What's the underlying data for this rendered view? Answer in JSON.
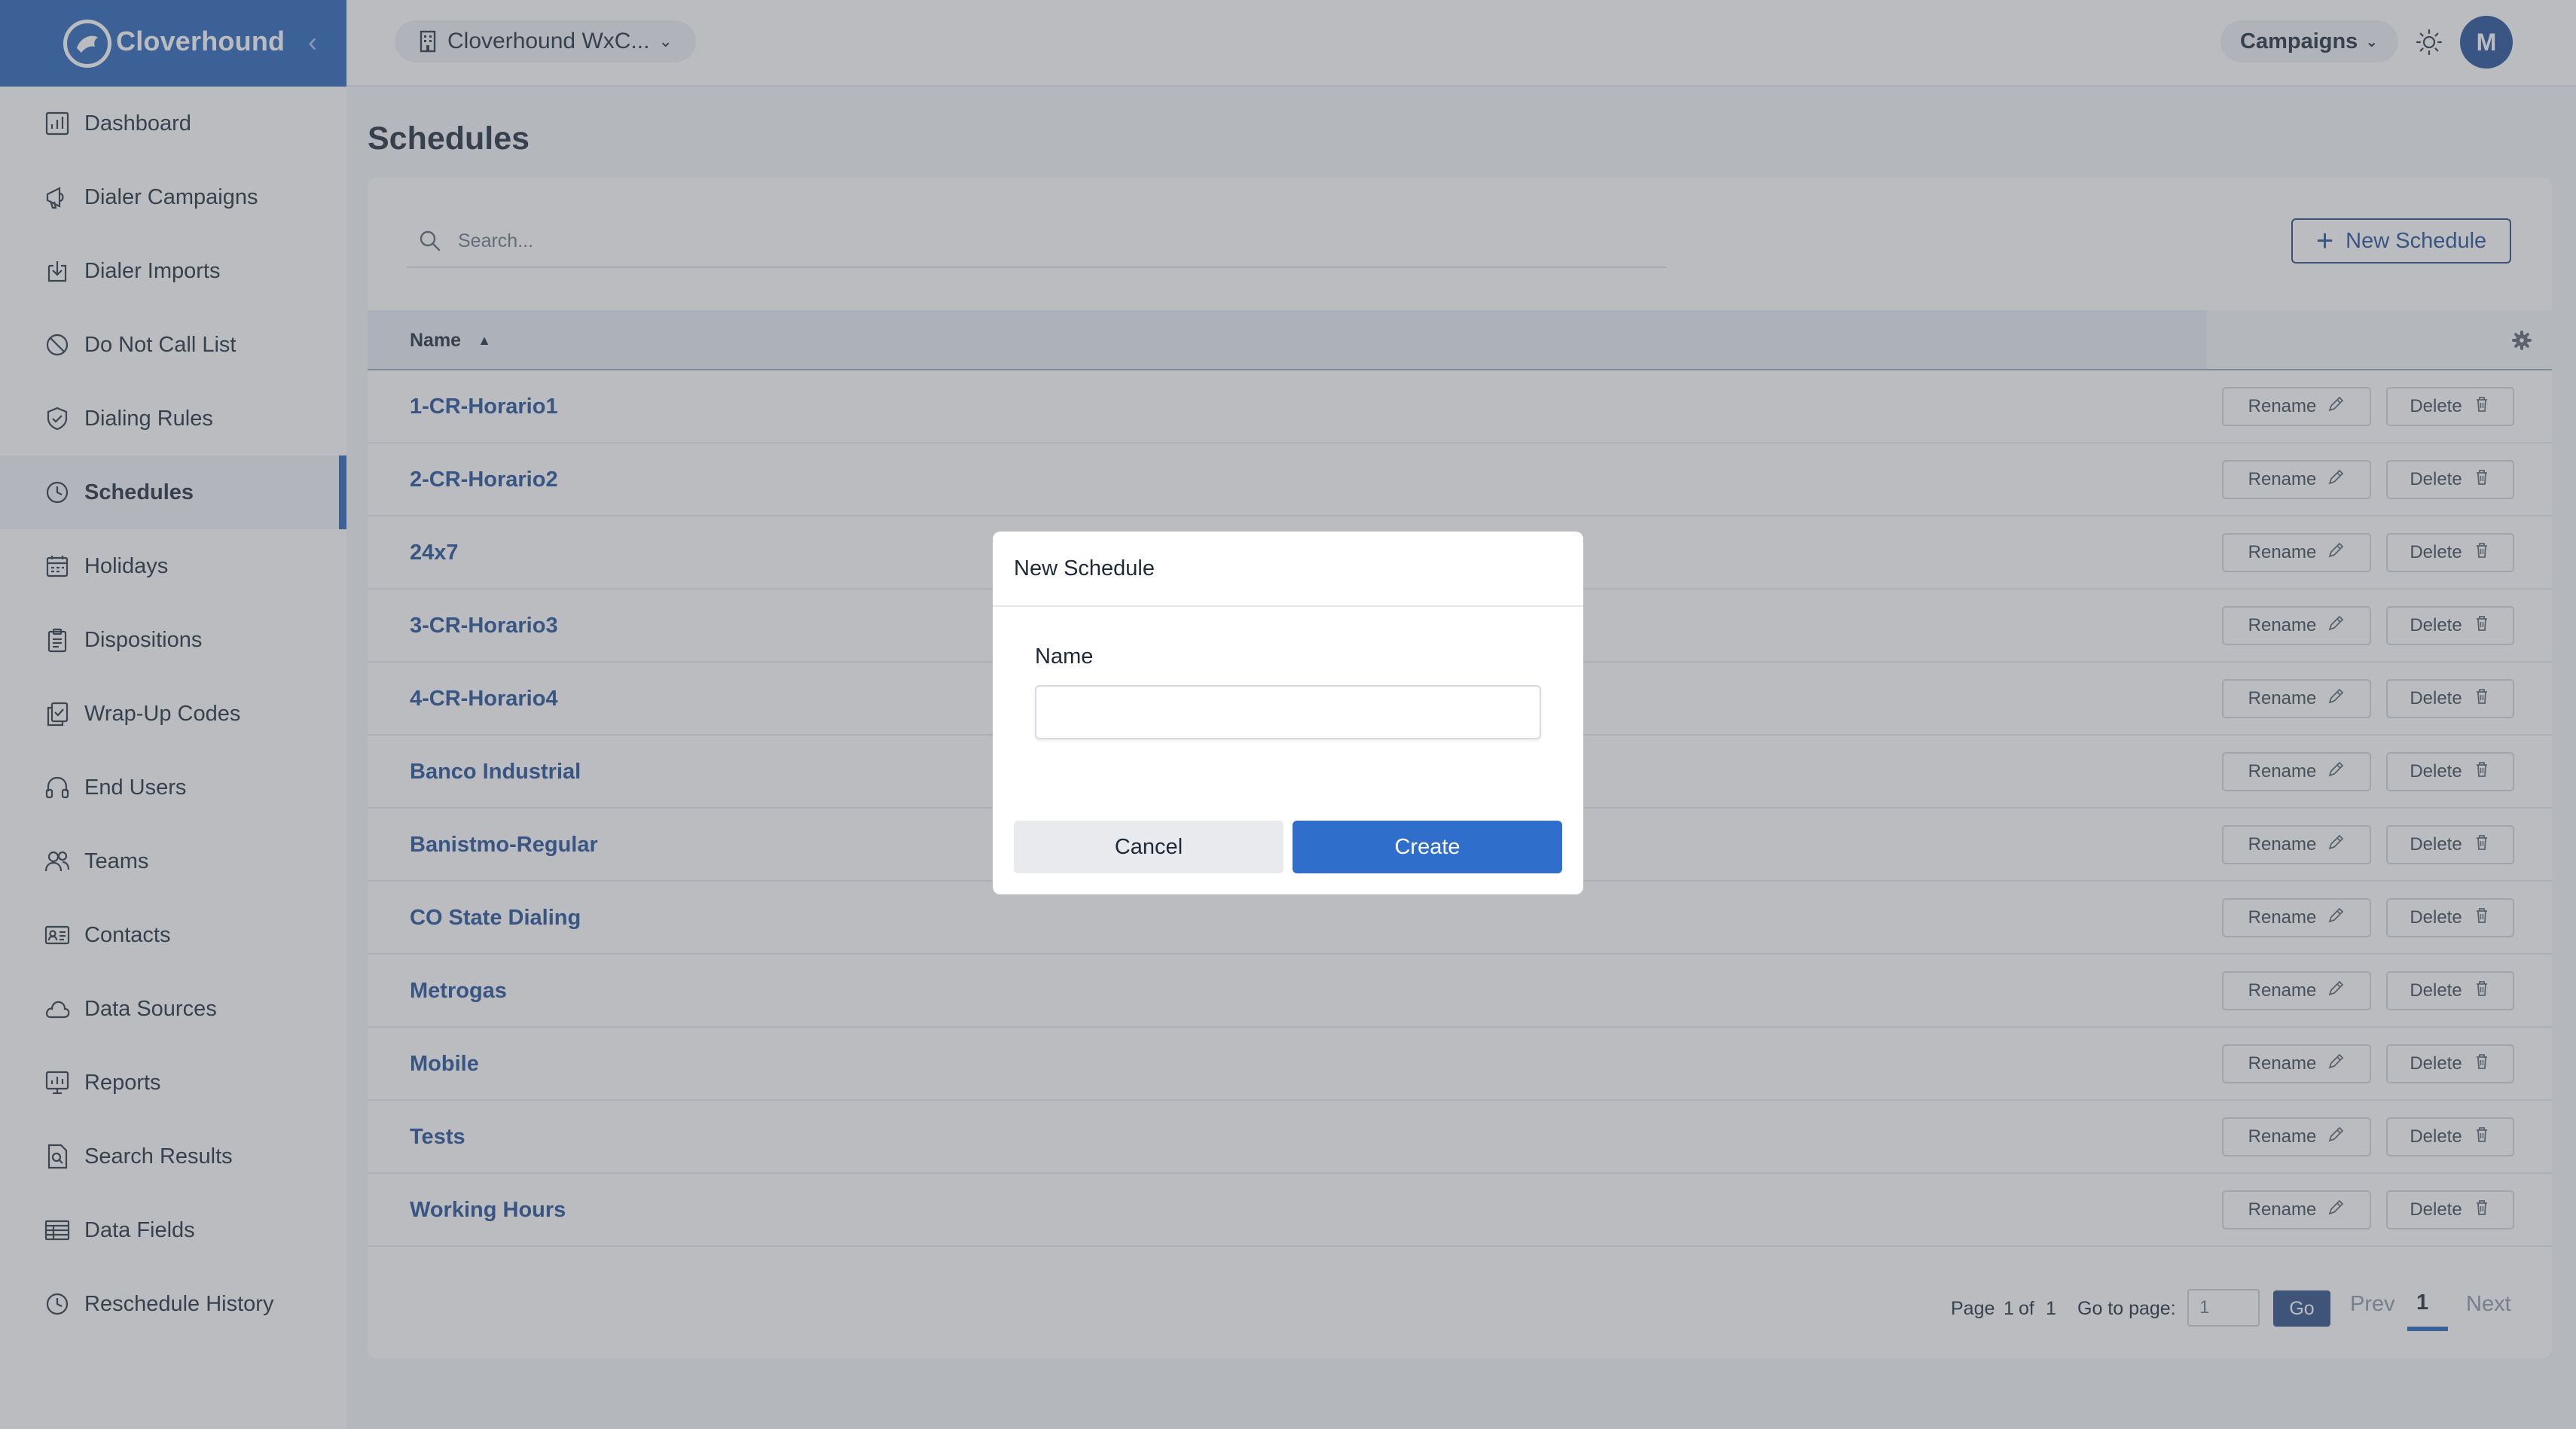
{
  "app": {
    "brand_name": "Cloverhound",
    "org_selector": "Cloverhound WxC...",
    "campaigns_menu": "Campaigns",
    "avatar_initial": "M",
    "accent_color": "#2563b8"
  },
  "sidebar": {
    "items": [
      {
        "label": "Dashboard",
        "icon": "chart-icon"
      },
      {
        "label": "Dialer Campaigns",
        "icon": "megaphone-icon"
      },
      {
        "label": "Dialer Imports",
        "icon": "import-icon"
      },
      {
        "label": "Do Not Call List",
        "icon": "ban-icon"
      },
      {
        "label": "Dialing Rules",
        "icon": "shield-icon"
      },
      {
        "label": "Schedules",
        "icon": "clock-icon",
        "active": true
      },
      {
        "label": "Holidays",
        "icon": "calendar-icon"
      },
      {
        "label": "Dispositions",
        "icon": "clipboard-icon"
      },
      {
        "label": "Wrap-Up Codes",
        "icon": "copy-icon"
      },
      {
        "label": "End Users",
        "icon": "headset-icon"
      },
      {
        "label": "Teams",
        "icon": "users-icon"
      },
      {
        "label": "Contacts",
        "icon": "contact-card-icon"
      },
      {
        "label": "Data Sources",
        "icon": "cloud-icon"
      },
      {
        "label": "Reports",
        "icon": "report-icon"
      },
      {
        "label": "Search Results",
        "icon": "search-file-icon"
      },
      {
        "label": "Data Fields",
        "icon": "table-icon"
      },
      {
        "label": "Reschedule History",
        "icon": "clock-icon"
      }
    ]
  },
  "main": {
    "title": "Schedules",
    "search_placeholder": "Search...",
    "new_button": "New Schedule",
    "column_name": "Name",
    "rename_label": "Rename",
    "delete_label": "Delete",
    "rows": [
      "1-CR-Horario1",
      "2-CR-Horario2",
      "24x7",
      "3-CR-Horario3",
      "4-CR-Horario4",
      "Banco Industrial",
      "Banistmo-Regular",
      "CO State Dialing",
      "Metrogas",
      "Mobile",
      "Tests",
      "Working Hours"
    ]
  },
  "pagination": {
    "page_label": "Page",
    "current_page": "1",
    "of_label": "of",
    "total_pages": "1",
    "goto_label": "Go to page:",
    "goto_value": "1",
    "go_button": "Go",
    "prev": "Prev",
    "page_number": "1",
    "next": "Next"
  },
  "modal": {
    "title": "New Schedule",
    "name_label": "Name",
    "name_value": "",
    "cancel": "Cancel",
    "create": "Create"
  }
}
